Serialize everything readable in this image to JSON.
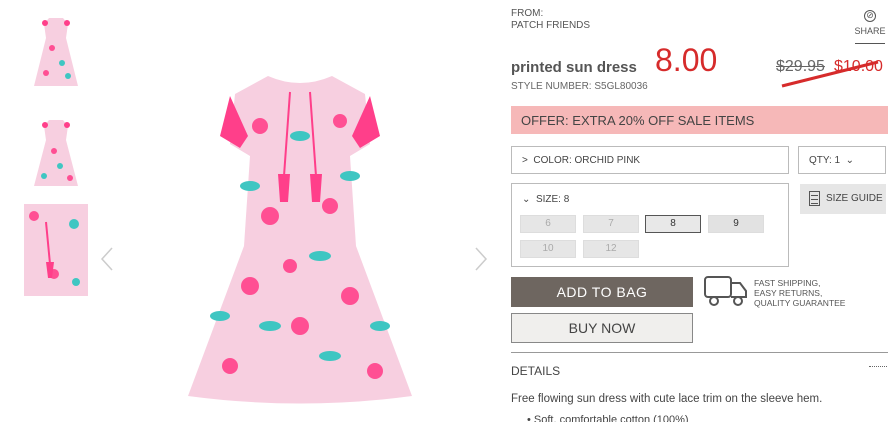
{
  "product": {
    "from_label": "FROM:",
    "brand": "PATCH FRIENDS",
    "title": "printed sun dress",
    "style_number": "STYLE NUMBER: S5GL80036",
    "sale_price": "8.00",
    "original_price": "$29.95",
    "now_price": "$10.00"
  },
  "share": {
    "label": "SHARE",
    "icon": "share-icon"
  },
  "offer": {
    "text": "OFFER: EXTRA 20% OFF SALE ITEMS"
  },
  "color": {
    "label": "COLOR: ORCHID PINK"
  },
  "qty": {
    "label": "QTY: 1"
  },
  "size": {
    "label": "SIZE: 8",
    "options": [
      {
        "label": "6",
        "state": "unavailable"
      },
      {
        "label": "7",
        "state": "unavailable"
      },
      {
        "label": "8",
        "state": "selected"
      },
      {
        "label": "9",
        "state": "available"
      },
      {
        "label": "10",
        "state": "unavailable"
      },
      {
        "label": "12",
        "state": "unavailable"
      }
    ]
  },
  "size_guide": {
    "label": "SIZE GUIDE"
  },
  "buttons": {
    "add_to_bag": "ADD TO BAG",
    "buy_now": "BUY NOW"
  },
  "shipping": {
    "line1": "FAST SHIPPING,",
    "line2": "EASY RETURNS,",
    "line3": "QUALITY GUARANTEE"
  },
  "details": {
    "heading": "DETAILS",
    "description": "Free flowing sun dress with cute lace trim on the sleeve hem.",
    "bullet": "• Soft, comfortable cotton (100%)"
  },
  "colors": {
    "sale_red": "#d62b2b",
    "offer_bg": "#f6b8b8",
    "dress_pink": "#f7cfe0",
    "trim_pink": "#ff3f8a",
    "leaf_teal": "#3fc6c2"
  }
}
